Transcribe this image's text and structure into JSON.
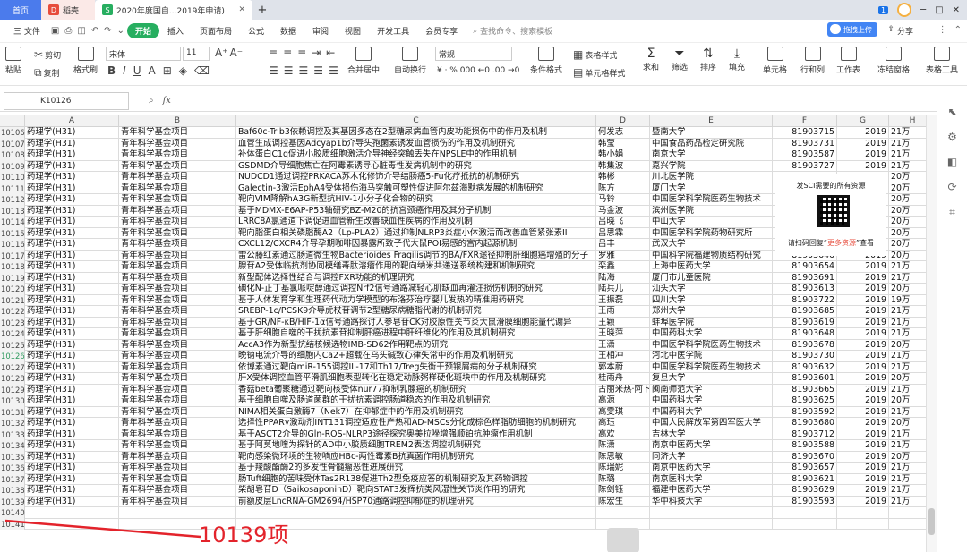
{
  "tabs": [
    {
      "label": "首页",
      "kind": "home"
    },
    {
      "label": "稻壳",
      "kind": "doc"
    },
    {
      "label": "2020年度国自...2019年申请)",
      "kind": "active"
    }
  ],
  "window": {
    "badge": "1",
    "controls": [
      "─",
      "□",
      "✕"
    ]
  },
  "menu": {
    "file": "三 文件",
    "start": "开始",
    "items": [
      "插入",
      "页面布局",
      "公式",
      "数据",
      "审阅",
      "视图",
      "开发工具",
      "会员专享"
    ],
    "search_placeholder": "查找命令、搜索模板",
    "upload": "拖拽上传",
    "share": "分享"
  },
  "ribbon": {
    "paste": "粘贴",
    "cut": "剪切",
    "copy": "复制",
    "format_brush": "格式刷",
    "font_name": "宋体",
    "font_size": "11",
    "merge_center": "合并居中",
    "wrap_text": "自动换行",
    "number_format": "常规",
    "percent_bar": "¥ · % 000 ←0 .00 →0",
    "cond_format": "条件格式",
    "table_style": "表格样式",
    "cell_style": "单元格样式",
    "sum": "求和",
    "filter": "筛选",
    "sort": "排序",
    "fill": "填充",
    "cell": "单元格",
    "row_col": "行和列",
    "worksheet": "工作表",
    "freeze": "冻结窗格",
    "table_tools": "表格工具"
  },
  "formula": {
    "cell_ref": "K10126",
    "fx": "fx"
  },
  "columns": [
    "A",
    "B",
    "C",
    "D",
    "E",
    "F",
    "G",
    "H"
  ],
  "rows": [
    {
      "n": "10106",
      "a": "药理学(H31)",
      "b": "青年科学基金项目",
      "c": "Baf60c-Trib3依赖调控及其基因多态在2型糖尿病血管内皮功能损伤中的作用及机制",
      "d": "何发志",
      "e": "暨南大学",
      "f": "81903715",
      "g": "2019",
      "h": "21万"
    },
    {
      "n": "10107",
      "a": "药理学(H31)",
      "b": "青年科学基金项目",
      "c": "血管生成调控基因Adcyap1b介导头孢菌素诱发血管损伤的作用及机制研究",
      "d": "韩莹",
      "e": "中国食品药品检定研究院",
      "f": "81903731",
      "g": "2019",
      "h": "21万"
    },
    {
      "n": "10108",
      "a": "药理学(H31)",
      "b": "青年科学基金项目",
      "c": "补体蛋白C1q促进小胶质细胞激活介导神经突触丢失在NPSLE中的作用机制",
      "d": "韩小娟",
      "e": "南京大学",
      "f": "81903587",
      "g": "2019",
      "h": "21万"
    },
    {
      "n": "10109",
      "a": "药理学(H31)",
      "b": "青年科学基金项目",
      "c": "GSDMD介导细胞焦亡在阿霉素诱导心脏毒性发病机制中的研究",
      "d": "韩集波",
      "e": "嘉兴学院",
      "f": "81903727",
      "g": "2019",
      "h": "21万"
    },
    {
      "n": "10110",
      "a": "药理学(H31)",
      "b": "青年科学基金项目",
      "c": "NUDCD1通过调控PRKACA苏木化修饰介导结肠癌5-Fu化疗抵抗的机制研究",
      "d": "韩彬",
      "e": "川北医学院",
      "f": "",
      "g": "",
      "h": "20万"
    },
    {
      "n": "10111",
      "a": "药理学(H31)",
      "b": "青年科学基金项目",
      "c": "Galectin-3激活EphA4受体损伤海马突触可塑性促进阿尔兹海默病发展的机制研究",
      "d": "陈方",
      "e": "厦门大学",
      "f": "",
      "g": "",
      "h": "20万"
    },
    {
      "n": "10112",
      "a": "药理学(H31)",
      "b": "青年科学基金项目",
      "c": "靶向VIM降解hA3G新型抗HIV-1小分子化合物的研究",
      "d": "马铃",
      "e": "中国医学科学院医药生物技术",
      "f": "",
      "g": "",
      "h": "20万"
    },
    {
      "n": "10113",
      "a": "药理学(H31)",
      "b": "青年科学基金项目",
      "c": "基于MDMX-E6AP-P53轴研究BZ-M20的抗宫颈癌作用及其分子机制",
      "d": "马金波",
      "e": "滨州医学院",
      "f": "",
      "g": "",
      "h": "20万"
    },
    {
      "n": "10114",
      "a": "药理学(H31)",
      "b": "青年科学基金项目",
      "c": "LRRC8A氯通道下调促进血管新生改善缺血性疾病的作用及机制",
      "d": "吕晓飞",
      "e": "中山大学",
      "f": "",
      "g": "",
      "h": "20万"
    },
    {
      "n": "10115",
      "a": "药理学(H31)",
      "b": "青年科学基金项目",
      "c": "靶向脂蛋白相关磷脂酶A2（Lp-PLA2）通过抑制NLRP3炎症小体激活而改善血管紧张素II",
      "d": "吕思霖",
      "e": "中国医学科学院药物研究所",
      "f": "",
      "g": "",
      "h": "20万"
    },
    {
      "n": "10116",
      "a": "药理学(H31)",
      "b": "青年科学基金项目",
      "c": "CXCL12/CXCR4介导孕期咖啡因暴露所致子代大鼠POI易感的宫内起源机制",
      "d": "吕丰",
      "e": "武汉大学",
      "f": "",
      "g": "",
      "h": "20万"
    },
    {
      "n": "10117",
      "a": "药理学(H31)",
      "b": "青年科学基金项目",
      "c": "雷公藤红素通过肠道微生物Bacterioides Fragilis调节的BA/FXR途径抑制肝细胞癌增殖的分子",
      "d": "罗雅",
      "e": "中国科学院福建物质结构研究",
      "f": "81903646",
      "g": "2019",
      "h": "20万"
    },
    {
      "n": "10118",
      "a": "药理学(H31)",
      "b": "青年科学基金项目",
      "c": "腺苷A2受体临抗剂协同模缮毒肽溶瘤作用的靶向纳米共递送系统构建和机制研究",
      "d": "栾鑫",
      "e": "上海中医药大学",
      "f": "81903654",
      "g": "2019",
      "h": "21万"
    },
    {
      "n": "10119",
      "a": "药理学(H31)",
      "b": "青年科学基金项目",
      "c": "新型配体选择性结合与调控FXR功能的机理研究",
      "d": "陆海",
      "e": "厦门市儿童医院",
      "f": "81903691",
      "g": "2019",
      "h": "21万"
    },
    {
      "n": "10120",
      "a": "药理学(H31)",
      "b": "青年科学基金项目",
      "c": "碘化N-正丁基氯哌啶醇通过调控Nrf2信号通路减轻心肌缺血再灌注损伤机制的研究",
      "d": "陆兵儿",
      "e": "汕头大学",
      "f": "81903613",
      "g": "2019",
      "h": "20万"
    },
    {
      "n": "10121",
      "a": "药理学(H31)",
      "b": "青年科学基金项目",
      "c": "基于人体发育学和生理药代动力学模型的布洛芬治疗婴儿发热的精准用药研究",
      "d": "王振磊",
      "e": "四川大学",
      "f": "81903722",
      "g": "2019",
      "h": "19万"
    },
    {
      "n": "10122",
      "a": "药理学(H31)",
      "b": "青年科学基金项目",
      "c": "SREBP-1c/PCSK9介导虎杖苷调节2型糖尿病糖脂代谢的机制研究",
      "d": "王雨",
      "e": "郑州大学",
      "f": "81903685",
      "g": "2019",
      "h": "21万"
    },
    {
      "n": "10123",
      "a": "药理学(H31)",
      "b": "青年科学基金项目",
      "c": "基于GR/NF-κB/HIF-1α信号通路探讨人参皂苷CK对胶原性关节炎大鼠滑膜细胞能量代谢异",
      "d": "王颖",
      "e": "蚌埠医学院",
      "f": "81903619",
      "g": "2019",
      "h": "21万"
    },
    {
      "n": "10124",
      "a": "药理学(H31)",
      "b": "青年科学基金项目",
      "c": "基于肝细胞自噬的干扰抗素苷抑制肝癌进程中肝纤维化的作用及其机制研究",
      "d": "王晓萍",
      "e": "中国药科大学",
      "f": "81903648",
      "g": "2019",
      "h": "21万"
    },
    {
      "n": "10125",
      "a": "药理学(H31)",
      "b": "青年科学基金项目",
      "c": "AccA3作为新型抗结核候选物IMB-SD62作用靶点的研究",
      "d": "王潇",
      "e": "中国医学科学院医药生物技术",
      "f": "81903678",
      "g": "2019",
      "h": "20万"
    },
    {
      "n": "10126",
      "a": "药理学(H31)",
      "b": "青年科学基金项目",
      "c": "晚钠电流介导的细胞内Ca2+超载在乌头碱致心律失常中的作用及机制研究",
      "d": "王相冲",
      "e": "河北中医学院",
      "f": "81903730",
      "g": "2019",
      "h": "21万",
      "selected": true
    },
    {
      "n": "10127",
      "a": "药理学(H31)",
      "b": "青年科学基金项目",
      "c": "依博素通过靶向miR-155调控IL-17和Th17/Treg失衡干预银屑病的分子机制研究",
      "d": "郭本蔚",
      "e": "中国医学科学院医药生物技术",
      "f": "81903632",
      "g": "2019",
      "h": "21万"
    },
    {
      "n": "10128",
      "a": "药理学(H31)",
      "b": "青年科学基金项目",
      "c": "肝X受体调控血管平滑肌细胞表型转化在稳定动脉粥样硬化斑块中的作用及机制研究",
      "d": "桂雨舟",
      "e": "复旦大学",
      "f": "81903601",
      "g": "2019",
      "h": "20万"
    },
    {
      "n": "10129",
      "a": "药理学(H31)",
      "b": "青年科学基金项目",
      "c": "香菇beta葡聚糖通过靶向核受体nur77抑制乳腺癌的机制研究",
      "d": "古丽米热·阿卜",
      "e": "闽南师范大学",
      "f": "81903665",
      "g": "2019",
      "h": "21万"
    },
    {
      "n": "10130",
      "a": "药理学(H31)",
      "b": "青年科学基金项目",
      "c": "基于细胞自噬及肠道菌群的干扰抗素调控肠道稳态的作用及机制研究",
      "d": "高源",
      "e": "中国药科大学",
      "f": "81903625",
      "g": "2019",
      "h": "20万"
    },
    {
      "n": "10131",
      "a": "药理学(H31)",
      "b": "青年科学基金项目",
      "c": "NIMA相关蛋白激酶7（Nek7）在抑郁症中的作用及机制研究",
      "d": "高雯琪",
      "e": "中国药科大学",
      "f": "81903592",
      "g": "2019",
      "h": "21万"
    },
    {
      "n": "10132",
      "a": "药理学(H31)",
      "b": "青年科学基金项目",
      "c": "选择性PPARγ激动剂INT131调控适应性产热和AD-MSCs分化成棕色样脂肪细胞的机制研究",
      "d": "高珏",
      "e": "中国人民解放军第四军医大学",
      "f": "81903680",
      "g": "2019",
      "h": "20万"
    },
    {
      "n": "10133",
      "a": "药理学(H31)",
      "b": "青年科学基金项目",
      "c": "基于ASCT2介导的Gln-ROS-NLRP3途径探究奥美拉唑增强顺铂抗肿瘤作用机制",
      "d": "高欢",
      "e": "吉林大学",
      "f": "81903712",
      "g": "2019",
      "h": "21万"
    },
    {
      "n": "10134",
      "a": "药理学(H31)",
      "b": "青年科学基金项目",
      "c": "基于阿莫地喹为探针的AD中小胶质细胞TREM2表达调控机制研究",
      "d": "陈潇",
      "e": "南京中医药大学",
      "f": "81903588",
      "g": "2019",
      "h": "21万"
    },
    {
      "n": "10135",
      "a": "药理学(H31)",
      "b": "青年科学基金项目",
      "c": "靶向感染微环境的生物响应HBc-两性霉素B抗真菌作用机制研究",
      "d": "陈思敏",
      "e": "同济大学",
      "f": "81903670",
      "g": "2019",
      "h": "20万"
    },
    {
      "n": "10136",
      "a": "药理学(H31)",
      "b": "青年科学基金项目",
      "c": "基于羧酸酯酶2的多发性骨髓瘤恶性进展研究",
      "d": "陈瑞妮",
      "e": "南京中医药大学",
      "f": "81903657",
      "g": "2019",
      "h": "21万"
    },
    {
      "n": "10137",
      "a": "药理学(H31)",
      "b": "青年科学基金项目",
      "c": "肠Tuft细胞的苦味受体Tas2R138促进Th2型免疫应答的机制研究及其药物调控",
      "d": "陈璐",
      "e": "南京医科大学",
      "f": "81903621",
      "g": "2019",
      "h": "21万"
    },
    {
      "n": "10138",
      "a": "药理学(H31)",
      "b": "青年科学基金项目",
      "c": "柴胡皂苷D（SaikosaponinD）靶向STAT3发挥抗类风湿性关节炎作用的研究",
      "d": "陈剑钰",
      "e": "福建中医药大学",
      "f": "81903629",
      "g": "2019",
      "h": "21万"
    },
    {
      "n": "10139",
      "a": "药理学(H31)",
      "b": "青年科学基金项目",
      "c": "前额皮层LncRNA-GM2694/HSP70通路调控抑郁症的机理研究",
      "d": "陈宏生",
      "e": "华中科技大学",
      "f": "81903593",
      "g": "2019",
      "h": "21万"
    },
    {
      "n": "10140",
      "a": "",
      "b": "",
      "c": "",
      "d": "",
      "e": "",
      "f": "",
      "g": "",
      "h": ""
    },
    {
      "n": "10141",
      "a": "",
      "b": "",
      "c": "",
      "d": "",
      "e": "",
      "f": "",
      "g": "",
      "h": ""
    }
  ],
  "qr": {
    "top": "发SCI需要的所有资源",
    "bottom_pre": "请扫码回复“",
    "bottom_red": "更多资源",
    "bottom_post": "”查看"
  },
  "annotation": "10139项"
}
